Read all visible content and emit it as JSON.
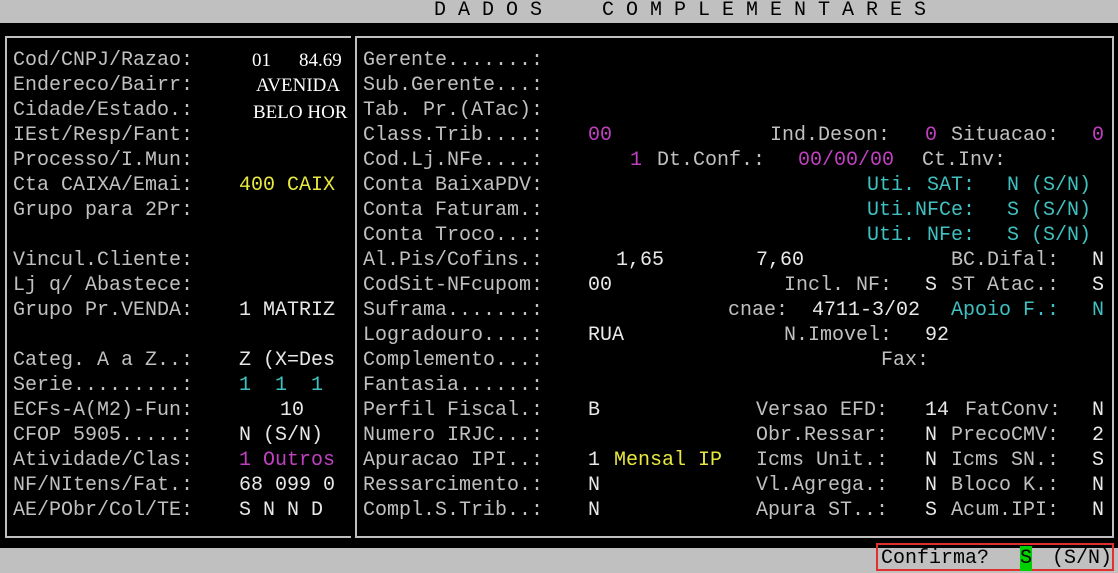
{
  "title": "DADOS  COMPLEMENTARES",
  "left": {
    "rows": [
      {
        "label": "Cod/CNPJ/Razao:",
        "value_a": "01",
        "value_b": "84.69"
      },
      {
        "label": "Endereco/Bairr:",
        "value": "AVENIDA"
      },
      {
        "label": "Cidade/Estado.:",
        "value": "BELO HOR"
      },
      {
        "label": "IEst/Resp/Fant:"
      },
      {
        "label": "Processo/I.Mun:"
      },
      {
        "label": "Cta CAIXA/Emai:",
        "value": "400 CAIX"
      },
      {
        "label": "Grupo para 2Pr:"
      },
      {
        "label": "Vincul.Cliente:"
      },
      {
        "label": "Lj q/ Abastece:"
      },
      {
        "label": "Grupo Pr.VENDA:",
        "value": "1 MATRIZ"
      },
      {
        "label": "Categ. A a Z..:",
        "value": "Z (X=Des"
      },
      {
        "label": "Serie.........:",
        "value": "1  1  1"
      },
      {
        "label": "ECFs-A(M2)-Fun:",
        "value": "10"
      },
      {
        "label": "CFOP 5905.....:",
        "value": "N (S/N)"
      },
      {
        "label": "Atividade/Clas:",
        "value": "1 Outros"
      },
      {
        "label": "NF/NItens/Fat.:",
        "value": "68 099 0"
      },
      {
        "label": "AE/PObr/Col/TE:",
        "value": "S N N D"
      }
    ]
  },
  "right": {
    "gerente": "Gerente.......:",
    "sub_gerente": "Sub.Gerente...:",
    "tab_pr": "Tab. Pr.(ATac):",
    "class_trib": {
      "label": "Class.Trib....:",
      "value": "00"
    },
    "ind_deson": {
      "label": "Ind.Deson:",
      "value": "0"
    },
    "situacao": {
      "label": "Situacao:",
      "value": "0"
    },
    "cod_lj": {
      "label": "Cod.Lj.NFe....:",
      "value": "1"
    },
    "dt_conf": {
      "label": "Dt.Conf.:",
      "value": "00/00/00"
    },
    "ct_inv": {
      "label": "Ct.Inv:"
    },
    "conta_baixa": "Conta BaixaPDV:",
    "uti_sat": {
      "label": "Uti. SAT:",
      "value": "N (S/N)"
    },
    "conta_fat": "Conta Faturam.:",
    "uti_nfce": {
      "label": "Uti.NFCe:",
      "value": "S (S/N)"
    },
    "conta_troco": "Conta Troco...:",
    "uti_nfe": {
      "label": "Uti. NFe:",
      "value": "S (S/N)"
    },
    "al_pis": {
      "label": "Al.Pis/Cofins.:",
      "value_a": "1,65",
      "value_b": "7,60"
    },
    "bc_difal": {
      "label": "BC.Difal:",
      "value": "N"
    },
    "codsit": {
      "label": "CodSit-NFcupom:",
      "value": "00"
    },
    "incl_nf": {
      "label": "Incl. NF:",
      "value": "S"
    },
    "st_atac": {
      "label": "ST Atac.:",
      "value": "S"
    },
    "suframa": {
      "label": "Suframa.......:"
    },
    "cnae": {
      "label": "cnae:",
      "value": "4711-3/02"
    },
    "apoio": {
      "label": "Apoio F.:",
      "value": "N"
    },
    "logradouro": {
      "label": "Logradouro....:",
      "value": "RUA"
    },
    "n_imovel": {
      "label": "N.Imovel:",
      "value": "92"
    },
    "complemento": "Complemento...:",
    "fax": "Fax:",
    "fantasia": "Fantasia......:",
    "perfil": {
      "label": "Perfil Fiscal.:",
      "value": "B"
    },
    "versao_efd": {
      "label": "Versao EFD:",
      "value": "14"
    },
    "fatconv": {
      "label": "FatConv:",
      "value": "N"
    },
    "irjc": "Numero IRJC...:",
    "obr_ressar": {
      "label": "Obr.Ressar:",
      "value": "N"
    },
    "precocmv": {
      "label": "PrecoCMV:",
      "value": "2"
    },
    "apuracao": {
      "label": "Apuracao IPI..:",
      "value": "1",
      "extra": "Mensal IP"
    },
    "icms_unit": {
      "label": "Icms Unit.:",
      "value": "N"
    },
    "icms_sn": {
      "label": "Icms SN.:",
      "value": "S"
    },
    "ressarcimento": {
      "label": "Ressarcimento.:",
      "value": "N"
    },
    "vl_agrega": {
      "label": "Vl.Agrega.:",
      "value": "N"
    },
    "bloco_k": {
      "label": "Bloco K.:",
      "value": "N"
    },
    "compl_strib": {
      "label": "Compl.S.Trib..:",
      "value": "N"
    },
    "apura_st": {
      "label": "Apura ST..:",
      "value": "S"
    },
    "acum_ipi": {
      "label": "Acum.IPI:",
      "value": "N"
    }
  },
  "confirm": {
    "label": "Confirma?",
    "value": "S",
    "hint": "(S/N)"
  }
}
